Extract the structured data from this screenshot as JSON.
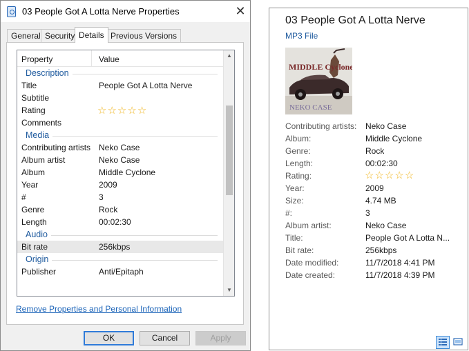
{
  "dialog": {
    "title": "03 People Got A Lotta Nerve Properties",
    "tabs": [
      {
        "label": "General"
      },
      {
        "label": "Security"
      },
      {
        "label": "Details"
      },
      {
        "label": "Previous Versions"
      }
    ],
    "columns": {
      "property": "Property",
      "value": "Value"
    },
    "groups": {
      "description": "Description",
      "media": "Media",
      "audio": "Audio",
      "origin": "Origin"
    },
    "props": {
      "title": {
        "k": "Title",
        "v": "People Got A Lotta Nerve"
      },
      "subtitle": {
        "k": "Subtitle",
        "v": ""
      },
      "rating": {
        "k": "Rating",
        "stars": 5
      },
      "comments": {
        "k": "Comments",
        "v": ""
      },
      "contributing_artists": {
        "k": "Contributing artists",
        "v": "Neko Case"
      },
      "album_artist": {
        "k": "Album artist",
        "v": "Neko Case"
      },
      "album": {
        "k": "Album",
        "v": "Middle Cyclone"
      },
      "year": {
        "k": "Year",
        "v": "2009"
      },
      "track": {
        "k": "#",
        "v": "3"
      },
      "genre": {
        "k": "Genre",
        "v": "Rock"
      },
      "length": {
        "k": "Length",
        "v": "00:02:30"
      },
      "bit_rate": {
        "k": "Bit rate",
        "v": "256kbps"
      },
      "publisher": {
        "k": "Publisher",
        "v": "Anti/Epitaph"
      }
    },
    "remove_link": "Remove Properties and Personal Information",
    "buttons": {
      "ok": "OK",
      "cancel": "Cancel",
      "apply": "Apply"
    }
  },
  "details_pane": {
    "title": "03 People Got A Lotta Nerve",
    "file_type": "MP3 File",
    "cover_text": {
      "top": "MIDDLE Cyclone",
      "bottom": "NEKO CASE"
    },
    "items": {
      "contributing_artists": {
        "k": "Contributing artists:",
        "v": "Neko Case"
      },
      "album": {
        "k": "Album:",
        "v": "Middle Cyclone"
      },
      "genre": {
        "k": "Genre:",
        "v": "Rock"
      },
      "length": {
        "k": "Length:",
        "v": "00:02:30"
      },
      "rating": {
        "k": "Rating:",
        "stars": 5
      },
      "year": {
        "k": "Year:",
        "v": "2009"
      },
      "size": {
        "k": "Size:",
        "v": "4.74 MB"
      },
      "track": {
        "k": "#:",
        "v": "3"
      },
      "album_artist": {
        "k": "Album artist:",
        "v": "Neko Case"
      },
      "title": {
        "k": "Title:",
        "v": "People Got A Lotta N..."
      },
      "bit_rate": {
        "k": "Bit rate:",
        "v": "256kbps"
      },
      "date_modified": {
        "k": "Date modified:",
        "v": "11/7/2018 4:41 PM"
      },
      "date_created": {
        "k": "Date created:",
        "v": "11/7/2018 4:39 PM"
      }
    }
  },
  "colors": {
    "accent": "#1e5a9e",
    "star": "#f0b419",
    "link": "#1a63b8"
  },
  "icons": [
    "file-properties-icon",
    "close-icon",
    "scroll-up-arrow-icon",
    "scroll-down-arrow-icon",
    "star-icon",
    "details-view-icon",
    "preview-view-icon"
  ]
}
